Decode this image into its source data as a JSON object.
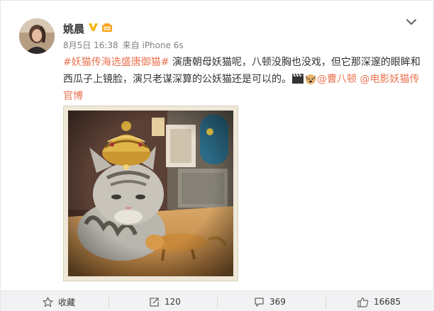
{
  "post": {
    "author": "姚晨",
    "date": "8月5日 16:38",
    "source": "来自 iPhone 6s",
    "hashtag": "#妖猫传海选盛唐御猫#",
    "text_main": "演唐朝母妖猫呢，八顿没胸也没戏，但它那深邃的眼眸和西瓜子上镜脸，演只老谋深算的公妖猫还是可以的。",
    "mention_1": "@曹八顿",
    "mention_2": "@电影妖猫传官博"
  },
  "icons": {
    "verified": "verified-v-badge-icon",
    "member": "member-badge-icon",
    "more": "chevron-down-icon",
    "clapper": "clapperboard-emoji-icon",
    "dog": "dog-face-emoji-icon",
    "favorite": "star-icon",
    "repost": "repost-icon",
    "comment": "comment-icon",
    "like": "thumbs-up-icon"
  },
  "actions": {
    "favorite_label": "收藏",
    "repost_count": "120",
    "comment_count": "369",
    "like_count": "16685"
  },
  "colors": {
    "link": "#eb7350",
    "verified": "#f5b400",
    "text": "#333333",
    "meta": "#808080",
    "footer_bg": "#f2f2f5"
  }
}
